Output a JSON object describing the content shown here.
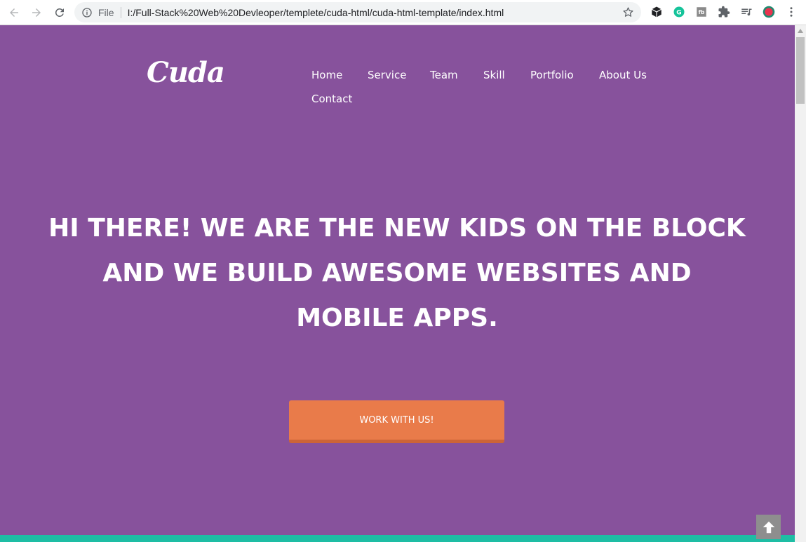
{
  "browser": {
    "file_label": "File",
    "url": "I:/Full-Stack%20Web%20Devleoper/templete/cuda-html/cuda-html-template/index.html",
    "icons": [
      "back-arrow-icon",
      "forward-arrow-icon",
      "reload-icon",
      "info-icon",
      "star-icon",
      "box-extension-icon",
      "grammarly-icon",
      "fb-extension-icon",
      "puzzle-extensions-icon",
      "media-queue-icon",
      "profile-avatar-icon",
      "kebab-menu-icon"
    ]
  },
  "site": {
    "logo": "Cuda",
    "nav": [
      "Home",
      "Service",
      "Team",
      "Skill",
      "Portfolio",
      "About Us",
      "Contact"
    ],
    "hero_lines": [
      "HI THERE! WE ARE THE NEW KIDS ON THE BLOCK",
      "AND WE BUILD AWESOME WEBSITES AND",
      "MOBILE APPS."
    ],
    "cta_label": "WORK WITH US!"
  },
  "colors": {
    "hero_background": "#87529c",
    "cta_background": "#e97b4a",
    "footer_band": "#1ebda4",
    "back_to_top": "#8e8e8e"
  }
}
